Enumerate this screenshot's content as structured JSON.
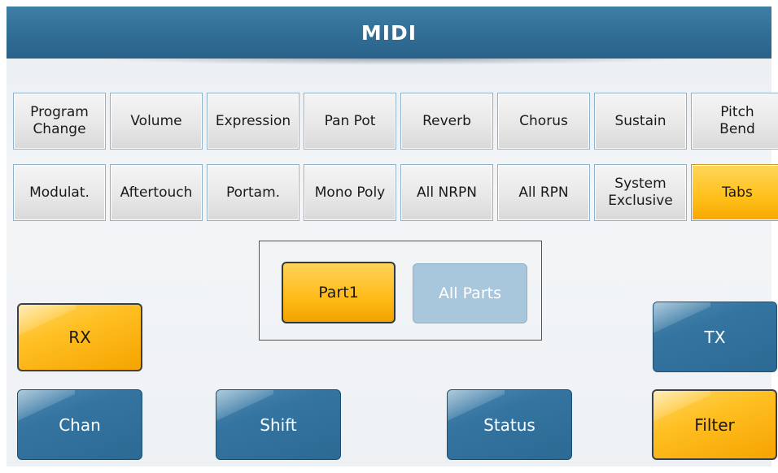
{
  "title": "MIDI",
  "row1": [
    {
      "label": "Program\nChange",
      "active": false
    },
    {
      "label": "Volume",
      "active": false
    },
    {
      "label": "Expression",
      "active": false
    },
    {
      "label": "Pan Pot",
      "active": false
    },
    {
      "label": "Reverb",
      "active": false
    },
    {
      "label": "Chorus",
      "active": false
    },
    {
      "label": "Sustain",
      "active": false
    },
    {
      "label": "Pitch\nBend",
      "active": false
    }
  ],
  "row2": [
    {
      "label": "Modulat.",
      "active": false
    },
    {
      "label": "Aftertouch",
      "active": false
    },
    {
      "label": "Portam.",
      "active": false
    },
    {
      "label": "Mono Poly",
      "active": false
    },
    {
      "label": "All NRPN",
      "active": false
    },
    {
      "label": "All RPN",
      "active": false
    },
    {
      "label": "System\nExclusive",
      "active": false
    },
    {
      "label": "Tabs",
      "active": true
    }
  ],
  "parts": {
    "part1": {
      "label": "Part1",
      "active": true
    },
    "all_parts": {
      "label": "All Parts",
      "active": false
    }
  },
  "buttons": {
    "rx": {
      "label": "RX",
      "active": true
    },
    "tx": {
      "label": "TX",
      "active": false
    },
    "chan": {
      "label": "Chan",
      "active": false
    },
    "shift": {
      "label": "Shift",
      "active": false
    },
    "status": {
      "label": "Status",
      "active": false
    },
    "filter": {
      "label": "Filter",
      "active": true
    }
  },
  "colors": {
    "header_blue": "#2f6c94",
    "active_yellow": "#ffbf1a",
    "inactive_tile": "#e8e8e8",
    "disabled_blue": "#a9c7dc"
  }
}
